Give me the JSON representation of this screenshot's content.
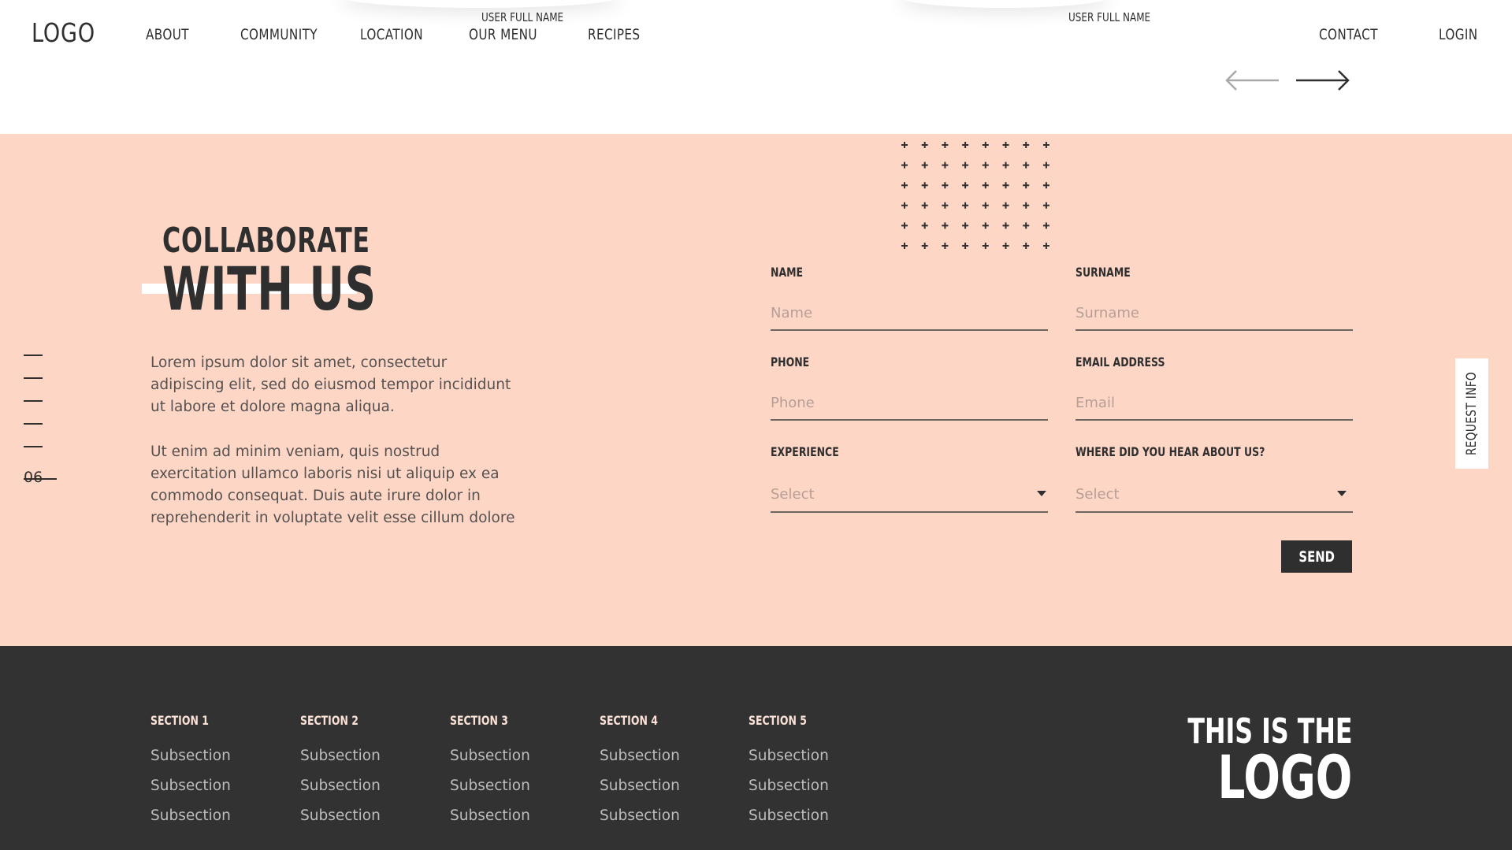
{
  "header": {
    "logo": "LOGO",
    "nav": [
      "ABOUT",
      "COMMUNITY",
      "LOCATION",
      "OUR MENU",
      "RECIPES",
      "CONTACT",
      "LOGIN"
    ],
    "user_name_1": "USER FULL NAME",
    "user_name_2": "USER FULL NAME",
    "prev_icon": "arrow-left-icon",
    "next_icon": "arrow-right-icon"
  },
  "hero": {
    "title_line1": "COLLABORATE",
    "title_line2": "WITH US",
    "paragraph1": "Lorem ipsum dolor sit amet, consectetur adipiscing elit, sed do eiusmod tempor incididunt ut labore et dolore magna aliqua.",
    "paragraph2": "Ut enim ad minim veniam, quis nostrud exercitation ullamco laboris nisi ut aliquip ex ea commodo consequat. Duis aute irure dolor in reprehenderit in voluptate velit esse cillum dolore"
  },
  "pager": {
    "current": "06"
  },
  "form": {
    "name_label": "NAME",
    "name_placeholder": "Name",
    "surname_label": "SURNAME",
    "surname_placeholder": "Surname",
    "phone_label": "PHONE",
    "phone_placeholder": "Phone",
    "email_label": "EMAIL ADDRESS",
    "email_placeholder": "Email",
    "experience_label": "EXPERIENCE",
    "experience_value": "Select",
    "source_label": "WHERE DID YOU HEAR ABOUT US?",
    "source_value": "Select",
    "send_label": "SEND"
  },
  "side_tab": {
    "label": "REQUEST INFO"
  },
  "footer": {
    "sections": [
      {
        "title": "SECTION 1",
        "items": [
          "Subsection",
          "Subsection",
          "Subsection"
        ]
      },
      {
        "title": "SECTION 2",
        "items": [
          "Subsection",
          "Subsection",
          "Subsection"
        ]
      },
      {
        "title": "SECTION 3",
        "items": [
          "Subsection",
          "Subsection",
          "Subsection"
        ]
      },
      {
        "title": "SECTION 4",
        "items": [
          "Subsection",
          "Subsection",
          "Subsection"
        ]
      },
      {
        "title": "SECTION 5",
        "items": [
          "Subsection",
          "Subsection",
          "Subsection"
        ]
      }
    ],
    "logo_line1": "THIS IS THE",
    "logo_line2": "LOGO"
  },
  "colors": {
    "accent_bg": "#fdd6c6",
    "dark": "#2f2f2f",
    "footer_bg": "#323232"
  }
}
